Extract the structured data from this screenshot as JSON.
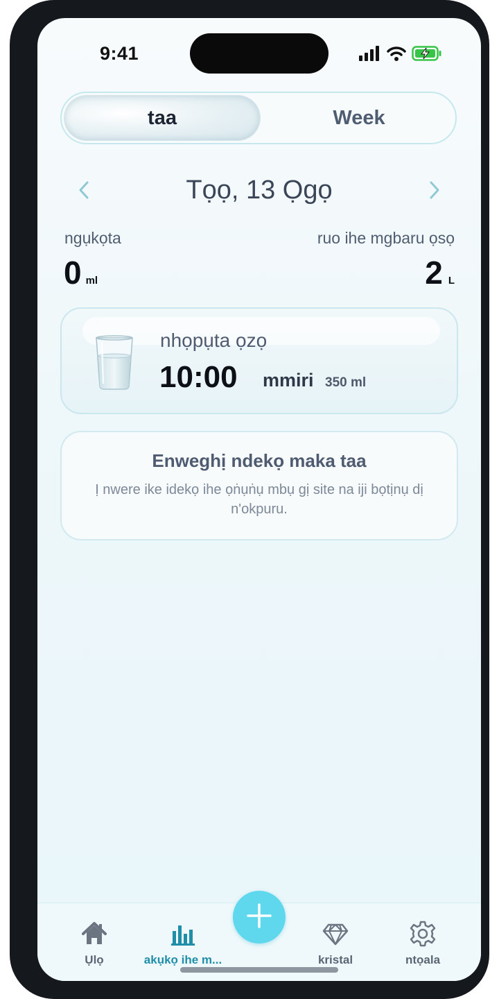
{
  "status_bar": {
    "time": "9:41",
    "icons": [
      "signal-icon",
      "wifi-icon",
      "battery-charging-icon"
    ]
  },
  "segment": {
    "options": [
      "taa",
      "Week"
    ],
    "selected": "taa"
  },
  "date_nav": {
    "prev_icon": "chevron-left-icon",
    "title": "Tọọ, 13 Ọgọ",
    "next_icon": "chevron-right-icon"
  },
  "totals": {
    "total_label": "ngụkọta",
    "total_value": "0",
    "total_unit": "ml",
    "goal_label": "ruo ihe mgbaru ọsọ",
    "goal_value": "2",
    "goal_unit": "L"
  },
  "next_drink": {
    "label": "nhọpụta ọzọ",
    "time": "10:00",
    "drink": "mmiri",
    "amount": "350 ml",
    "icon": "water-glass-icon"
  },
  "empty_state": {
    "title": "Enweghị ndekọ maka taa",
    "body": "Ị nwere ike idekọ ihe ọṅụṅụ mbụ gị site na iji bọtịnụ dị n'okpuru."
  },
  "tabbar": {
    "items": [
      {
        "label": "Ụlọ",
        "icon": "home-icon",
        "active": false
      },
      {
        "label": "akụkọ ihe m...",
        "icon": "bar-chart-icon",
        "active": true
      },
      {
        "label": "kristal",
        "icon": "diamond-icon",
        "active": false
      },
      {
        "label": "ntọala",
        "icon": "gear-icon",
        "active": false
      }
    ],
    "add_icon": "plus-icon"
  },
  "colors": {
    "accent": "#5fd8ee",
    "active_tab": "#1f8fa9",
    "text_dark": "#0d1117"
  }
}
